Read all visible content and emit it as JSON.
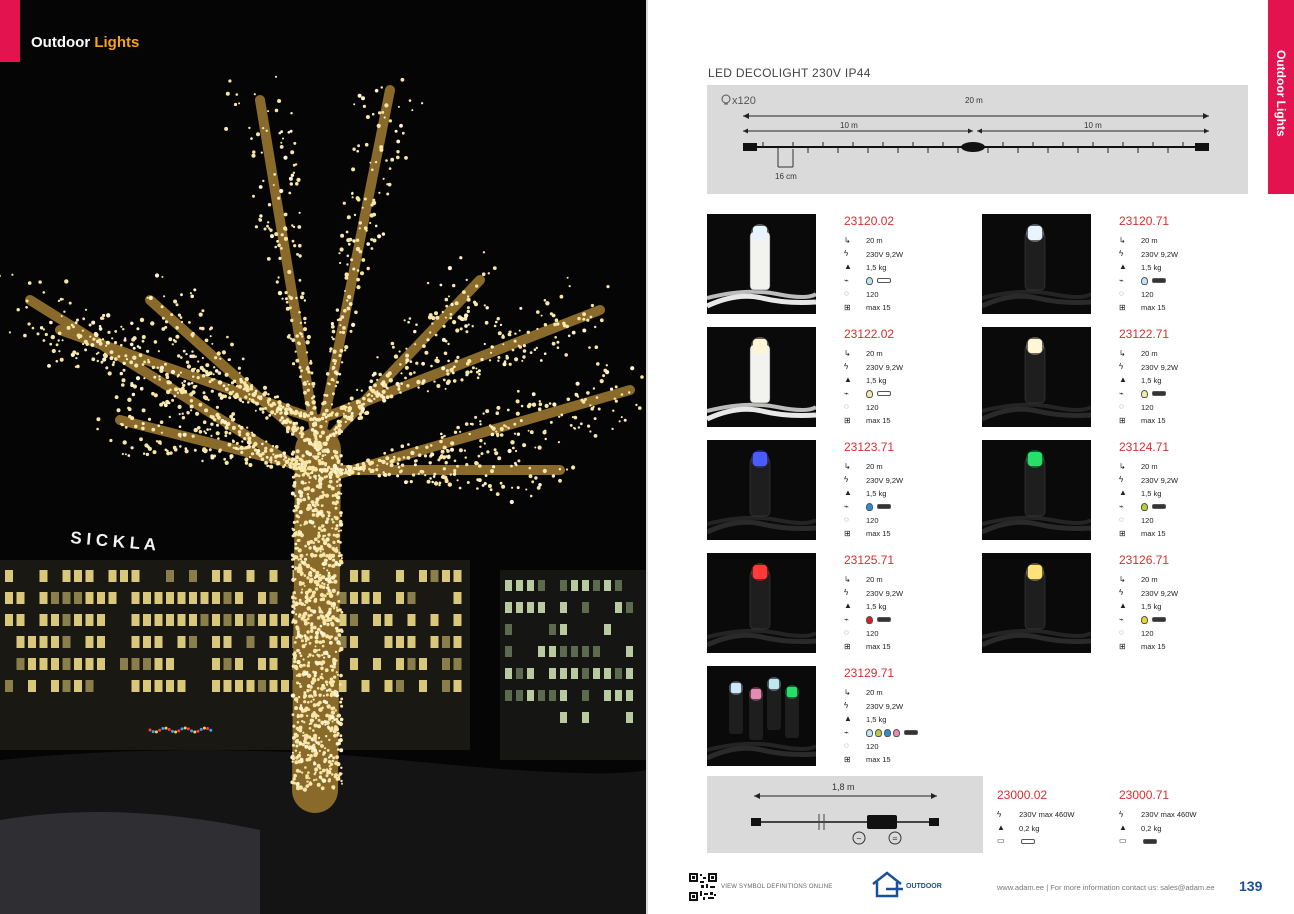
{
  "left": {
    "title_white": "Outdoor",
    "title_accent": "Lights",
    "sign_text": "S I C K L A"
  },
  "side_tab": "Outdoor Lights",
  "section_title": "LED DECOLIGHT 230V IP44",
  "diagram": {
    "bulb_count": "x120",
    "total_length": "20 m",
    "left_length": "10 m",
    "right_length": "10 m",
    "spacing": "16 cm"
  },
  "products": [
    {
      "code": "23120.02",
      "length": "20 m",
      "power": "230V 9,2W",
      "weight": "1,5 kg",
      "bulbs": "120",
      "connect": "max 15",
      "bulb_colors": [
        "#bfe6f2"
      ],
      "led_color": "#e8f4ff",
      "cable": "#e8e8e8"
    },
    {
      "code": "23120.71",
      "length": "20 m",
      "power": "230V 9,2W",
      "weight": "1,5 kg",
      "bulbs": "120",
      "connect": "max 15",
      "bulb_colors": [
        "#bfe6f2"
      ],
      "led_color": "#e8f4ff",
      "cable": "#2a2a2a"
    },
    {
      "code": "23122.02",
      "length": "20 m",
      "power": "230V 9,2W",
      "weight": "1,5 kg",
      "bulbs": "120",
      "connect": "max 15",
      "bulb_colors": [
        "#f6eaa8"
      ],
      "led_color": "#fff6d6",
      "cable": "#e8e8e8"
    },
    {
      "code": "23122.71",
      "length": "20 m",
      "power": "230V 9,2W",
      "weight": "1,5 kg",
      "bulbs": "120",
      "connect": "max 15",
      "bulb_colors": [
        "#f6eaa8"
      ],
      "led_color": "#fff6d6",
      "cable": "#2a2a2a"
    },
    {
      "code": "23123.71",
      "length": "20 m",
      "power": "230V 9,2W",
      "weight": "1,5 kg",
      "bulbs": "120",
      "connect": "max 15",
      "bulb_colors": [
        "#2a8fd4"
      ],
      "led_color": "#4a5cff",
      "cable": "#2a2a2a"
    },
    {
      "code": "23124.71",
      "length": "20 m",
      "power": "230V 9,2W",
      "weight": "1,5 kg",
      "bulbs": "120",
      "connect": "max 15",
      "bulb_colors": [
        "#b8cf3a"
      ],
      "led_color": "#27e06a",
      "cable": "#2a2a2a"
    },
    {
      "code": "23125.71",
      "length": "20 m",
      "power": "230V 9,2W",
      "weight": "1,5 kg",
      "bulbs": "120",
      "connect": "max 15",
      "bulb_colors": [
        "#d61f1f"
      ],
      "led_color": "#ff3a3a",
      "cable": "#2a2a2a"
    },
    {
      "code": "23126.71",
      "length": "20 m",
      "power": "230V 9,2W",
      "weight": "1,5 kg",
      "bulbs": "120",
      "connect": "max 15",
      "bulb_colors": [
        "#e6d82a"
      ],
      "led_color": "#ffe37a",
      "cable": "#2a2a2a"
    },
    {
      "code": "23129.71",
      "length": "20 m",
      "power": "230V 9,2W",
      "weight": "1,5 kg",
      "bulbs": "120",
      "connect": "max 15",
      "bulb_colors": [
        "#bfe6f2",
        "#b8cf3a",
        "#2a8fd4",
        "#e58ab5"
      ],
      "led_color": "#cfe8ff",
      "cable": "#2a2a2a"
    }
  ],
  "adapter": {
    "length": "1,8 m"
  },
  "accessories": [
    {
      "code": "23000.02",
      "power": "230V max 460W",
      "weight": "0,2 kg",
      "cable": "#e8e8e8"
    },
    {
      "code": "23000.71",
      "power": "230V max 460W",
      "weight": "0,2 kg",
      "cable": "#2a2a2a"
    }
  ],
  "footer": {
    "qr_text": "VIEW SYMBOL DEFINITIONS ONLINE",
    "logo_text": "OUTDOOR",
    "contact": "www.adam.ee  |  For more information contact us: sales@adam.ee",
    "page_number": "139"
  },
  "colors": {
    "accent_red": "#e2134f",
    "code_red": "#d92e2e",
    "brand_blue": "#1a4f9c",
    "accent_orange": "#f7a21b"
  }
}
